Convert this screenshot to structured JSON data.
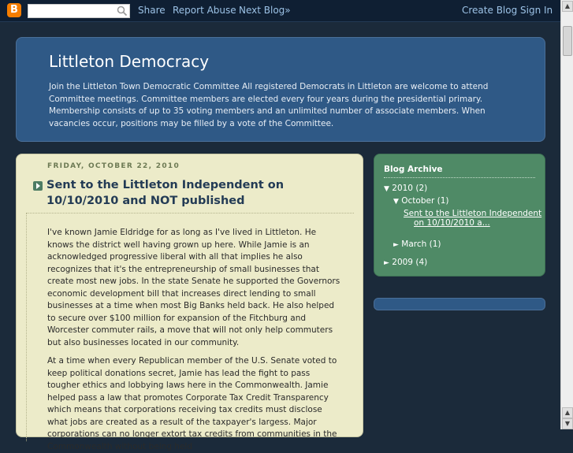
{
  "navbar": {
    "logo_letter": "B",
    "search_value": "",
    "links": {
      "share": "Share",
      "report": "Report Abuse",
      "next": "Next Blog»",
      "create": "Create Blog",
      "signin": "Sign In"
    }
  },
  "header": {
    "title": "Littleton Democracy",
    "description": "Join the Littleton Town Democratic Committee All registered Democrats in Littleton are welcome to attend Committee meetings. Committee members are elected every four years during the presidential primary. Membership consists of up to 35 voting members and an unlimited number of associate members. When vacancies occur, positions may be filled by a vote of the Committee."
  },
  "post": {
    "date": "FRIDAY, OCTOBER 22, 2010",
    "title": "Sent to the Littleton Independent on 10/10/2010 and NOT published",
    "paragraphs": [
      "I've known Jamie Eldridge for as long as I've lived in Littleton. He knows the district well having grown up here. While Jamie is an acknowledged progressive liberal with all that implies he also recognizes that it's the entrepreneurship of small businesses that create most new jobs. In the state Senate he supported the Governors economic development bill that increases direct lending to small businesses at a time when most Big Banks held back. He also helped to secure over $100 million for expansion of the Fitchburg and Worcester commuter rails, a move that will not only help commuters but also businesses located in our community.",
      "At a time when every Republican member of the U.S. Senate voted to keep political donations secret, Jamie has lead the fight to pass tougher ethics and lobbying laws here in the Commonwealth. Jamie helped pass a law that promotes Corporate Tax Credit Transparency which means that corporations receiving tax credits must disclose what jobs are created as a result of the taxpayer's largess. Major corporations can no longer extort tax credits from communities in the Commonwealth without being held"
    ]
  },
  "sidebar": {
    "heading": "Blog Archive",
    "year_2010": "2010",
    "year_2010_count": "(2)",
    "october": "October",
    "october_count": "(1)",
    "october_post_line1": "Sent to the Littleton Independent",
    "october_post_line2": "on 10/10/2010 a...",
    "march": "March",
    "march_count": "(1)",
    "year_2009": "2009",
    "year_2009_count": "(4)"
  },
  "colors": {
    "background": "#1b2a3a",
    "header_bg": "#2f5986",
    "post_bg": "#ecebc9",
    "sidebar_bg": "#4f8a66"
  }
}
